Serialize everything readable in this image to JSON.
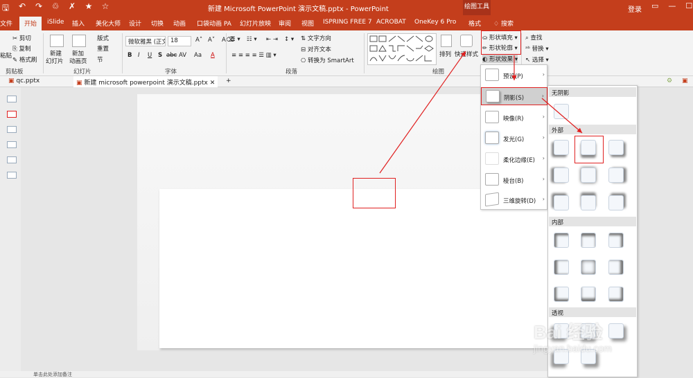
{
  "titlebar": {
    "qat_icons": [
      "save-icon",
      "undo-icon",
      "redo-icon",
      "format-painter-icon",
      "shuffle-icon",
      "star-icon",
      "star-outline-icon"
    ],
    "qat_glyphs": [
      "🖫",
      "↶",
      "↷",
      "♲",
      "✗",
      "★",
      "☆"
    ],
    "title": "新建 Microsoft PowerPoint 演示文稿.pptx - PowerPoint",
    "context_tools": "绘图工具",
    "login": "登录",
    "controls": [
      "▭",
      "—",
      "☐"
    ]
  },
  "tabs": [
    "文件",
    "开始",
    "iSlide",
    "插入",
    "美化大师",
    "设计",
    "切换",
    "动画",
    "口袋动画 PA",
    "幻灯片放映",
    "审阅",
    "视图",
    "ISPRING FREE 7",
    "ACROBAT",
    "OneKey 6 Pro",
    "格式",
    "搜索"
  ],
  "active_tab": "开始",
  "ribbon": {
    "clipboard": {
      "cut": "剪切",
      "copy": "复制",
      "format_painter": "格式刷",
      "paste": "粘贴",
      "label": "剪贴板"
    },
    "slides": {
      "new_slide_1": "新建",
      "new_slide_2": "幻灯片",
      "add_anim_1": "新加",
      "add_anim_2": "动画页",
      "layout": "版式",
      "reset": "重置",
      "section": "节",
      "label": "幻灯片"
    },
    "font": {
      "font_name": "微软雅黑 (正文)",
      "font_size": "18",
      "bold": "B",
      "italic": "I",
      "underline": "U",
      "strike": "S",
      "shadow": "abc",
      "spacing": "AV",
      "case": "Aa",
      "color": "A",
      "label": "字体"
    },
    "paragraph": {
      "text_direction": "文字方向",
      "align_text": "对齐文本",
      "to_smartart": "转换为 SmartArt",
      "label": "段落"
    },
    "drawing": {
      "arrange": "排列",
      "quick_styles": "快速样式",
      "shape_fill": "形状填充",
      "shape_outline": "形状轮廓",
      "shape_effects": "形状效果",
      "label": "绘图"
    },
    "editing": {
      "find": "查找",
      "replace": "替换",
      "select": "选择"
    }
  },
  "doc_tabs": [
    "qc.pptx",
    "新建 microsoft powerpoint 演示文稿.pptx"
  ],
  "effects_menu": [
    {
      "label": "预设(P)",
      "arrow": "›"
    },
    {
      "label": "阴影(S)",
      "arrow": "›"
    },
    {
      "label": "映像(R)",
      "arrow": "›"
    },
    {
      "label": "发光(G)",
      "arrow": "›"
    },
    {
      "label": "柔化边缘(E)",
      "arrow": "›"
    },
    {
      "label": "棱台(B)",
      "arrow": "›"
    },
    {
      "label": "三维旋转(D)",
      "arrow": "›"
    }
  ],
  "shadow_gallery": {
    "no_shadow": "无阴影",
    "outer": "外部",
    "inner": "内部",
    "perspective": "透视"
  },
  "status": "单击此处添加备注",
  "watermark": {
    "main": "Bai 经验",
    "sub": "jingyan.baidu.com"
  }
}
